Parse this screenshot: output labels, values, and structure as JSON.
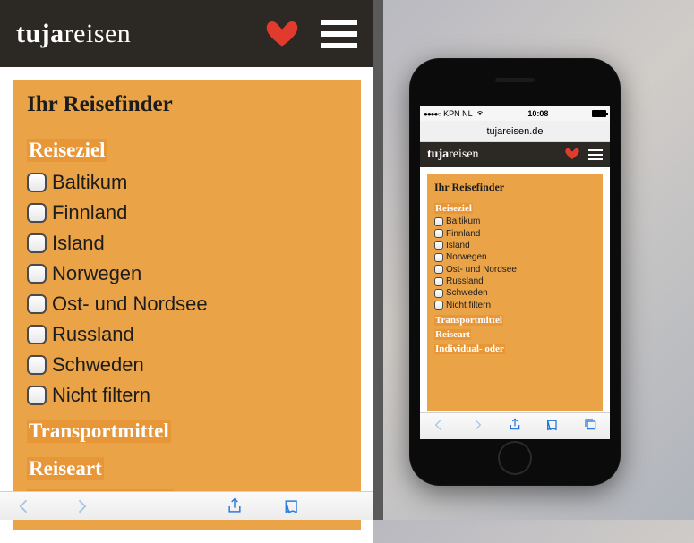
{
  "brand": {
    "part1": "tuja",
    "part2": "reisen"
  },
  "finder": {
    "title": "Ihr Reisefinder",
    "sections": [
      {
        "label": "Reiseziel"
      },
      {
        "label": "Transportmittel"
      },
      {
        "label": "Reiseart"
      },
      {
        "label": "Individual- oder"
      }
    ],
    "destinations": [
      "Baltikum",
      "Finnland",
      "Island",
      "Norwegen",
      "Ost- und Nordsee",
      "Russland",
      "Schweden",
      "Nicht filtern"
    ]
  },
  "phone": {
    "carrier": "KPN NL",
    "time": "10:08",
    "url": "tujareisen.de",
    "signal_dots": "●●●●○"
  }
}
